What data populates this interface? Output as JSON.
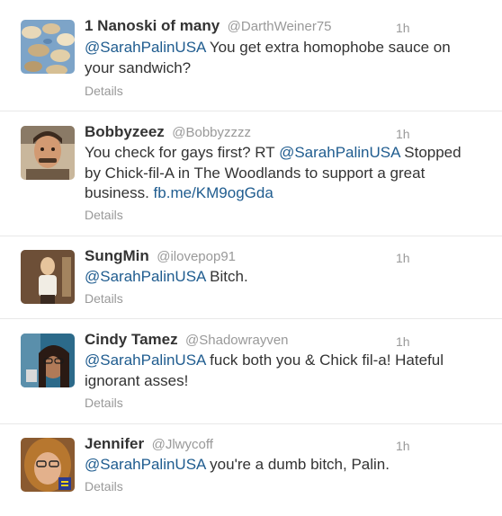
{
  "tweets": [
    {
      "name": "1 Nanoski of many",
      "handle": "@DarthWeiner75",
      "time": "1h",
      "mention": "@SarahPalinUSA",
      "text": " You get extra homophobe sauce on your sandwich?",
      "details": "Details"
    },
    {
      "name": "Bobbyzeez",
      "handle": "@Bobbyzzzz",
      "time": "1h",
      "text_before": "You check for gays first? RT ",
      "mention": "@SarahPalinUSA",
      "text_after": " Stopped by Chick-fil-A in The Woodlands to support a great business. ",
      "link": "fb.me/KM9ogGda",
      "details": "Details"
    },
    {
      "name": "SungMin",
      "handle": "@ilovepop91",
      "time": "1h",
      "mention": "@SarahPalinUSA",
      "text": " Bitch.",
      "details": "Details"
    },
    {
      "name": "Cindy Tamez",
      "handle": "@Shadowrayven",
      "time": "1h",
      "mention": "@SarahPalinUSA",
      "text": " fuck both you & Chick fil-a! Hateful ignorant asses!",
      "details": "Details"
    },
    {
      "name": "Jennifer",
      "handle": "@Jlwycoff",
      "time": "1h",
      "mention": "@SarahPalinUSA",
      "text": " you're a dumb bitch, Palin.",
      "details": "Details"
    }
  ],
  "colors": {
    "mention": "#1f5c8f",
    "muted": "#999999",
    "text": "#333333",
    "divider": "#e8e8e8"
  }
}
